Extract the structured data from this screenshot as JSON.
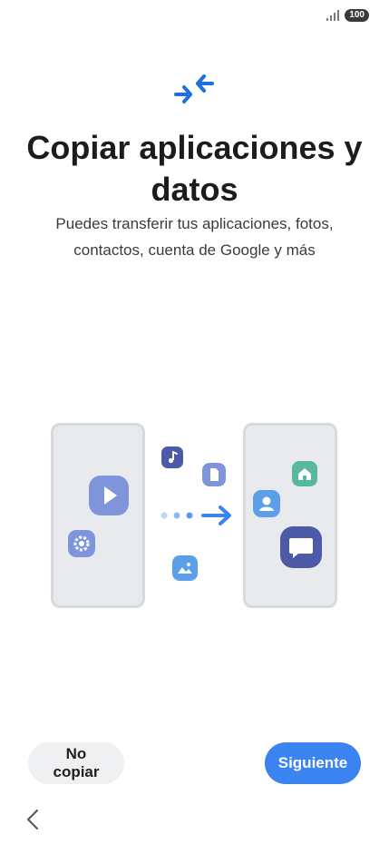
{
  "status_bar": {
    "battery": "100"
  },
  "title": "Copiar aplicaciones y datos",
  "subtitle": "Puedes transferir tus aplicaciones, fotos, contactos, cuenta de Google y más",
  "buttons": {
    "secondary": "No copiar",
    "primary": "Siguiente"
  },
  "colors": {
    "primary": "#3a83f1",
    "phone_frame": "#d7dade",
    "phone_fill": "#e8eaee"
  },
  "icons": [
    "transfer-arrows-icon",
    "play-icon",
    "gear-icon",
    "music-note-icon",
    "document-icon",
    "image-icon",
    "home-icon",
    "contact-icon",
    "chat-bubble-icon",
    "back-chevron-icon"
  ]
}
